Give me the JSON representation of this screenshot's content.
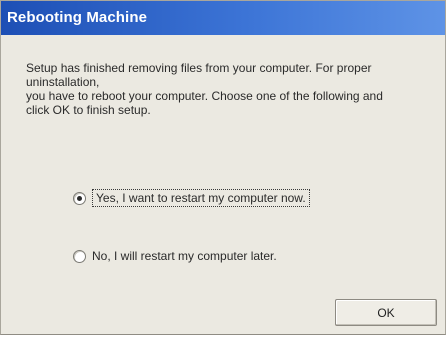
{
  "window": {
    "title": "Rebooting Machine"
  },
  "message": {
    "line1": "Setup has finished removing files from your computer. For proper",
    "line2": "uninstallation,",
    "line3": "you have to reboot your computer. Choose one of the following and",
    "line4": "click OK to finish setup."
  },
  "options": [
    {
      "label": "Yes, I want to restart my computer now.",
      "selected": true
    },
    {
      "label": "No, I will restart my computer later.",
      "selected": false
    }
  ],
  "buttons": {
    "ok_label": "OK"
  },
  "colors": {
    "titlebar_start": "#1d4fb5",
    "titlebar_end": "#5e93e6",
    "dialog_bg": "#ebe9e1"
  }
}
